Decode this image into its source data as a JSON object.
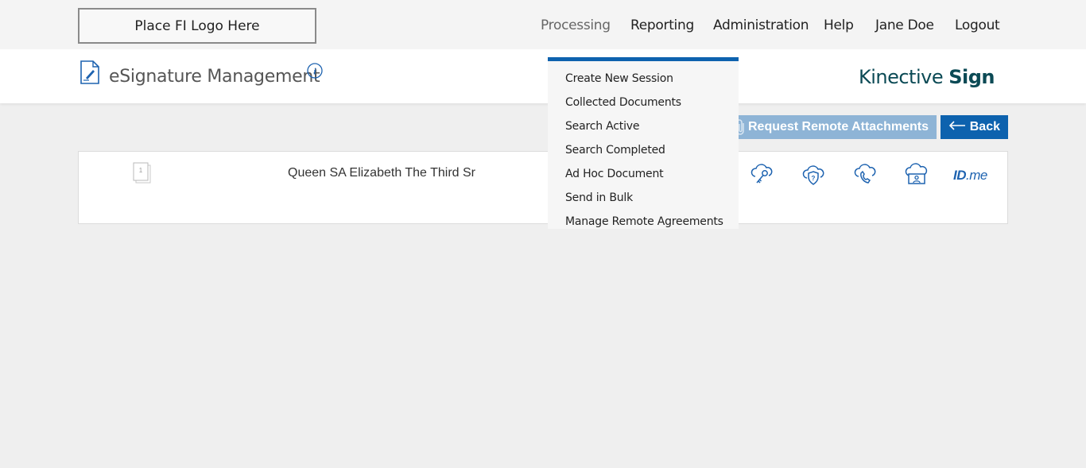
{
  "topbar": {
    "logo_text": "Place FI Logo Here",
    "nav": [
      {
        "label": "Processing"
      },
      {
        "label": "Reporting"
      },
      {
        "label": "Administration"
      },
      {
        "label": "Help"
      },
      {
        "label": "Jane Doe"
      },
      {
        "label": "Logout"
      }
    ]
  },
  "header": {
    "title": "eSignature Management",
    "brand_light": "Kinective ",
    "brand_bold": "Sign"
  },
  "actions": {
    "request_label": "Request Remote Attachments",
    "back_label": "Back"
  },
  "signer": {
    "page_count": "1",
    "name": "Queen SA Elizabeth The Third Sr",
    "auth_icons": [
      "cloud-key-icon",
      "cloud-shield-question-icon",
      "cloud-phone-icon",
      "cloud-id-card-icon"
    ],
    "idme_main": "ID",
    "idme_suffix": ".me"
  },
  "dropdown": {
    "items": [
      {
        "label": "Create New Session"
      },
      {
        "label": "Collected Documents"
      },
      {
        "label": "Search Active"
      },
      {
        "label": "Search Completed"
      },
      {
        "label": "Ad Hoc Document"
      },
      {
        "label": "Send in Bulk"
      },
      {
        "label": "Manage Remote Agreements"
      }
    ]
  },
  "colors": {
    "primary": "#0d62ae",
    "primary_disabled": "#8eb4d6",
    "brand": "#0b4a55",
    "background": "#efefef"
  }
}
